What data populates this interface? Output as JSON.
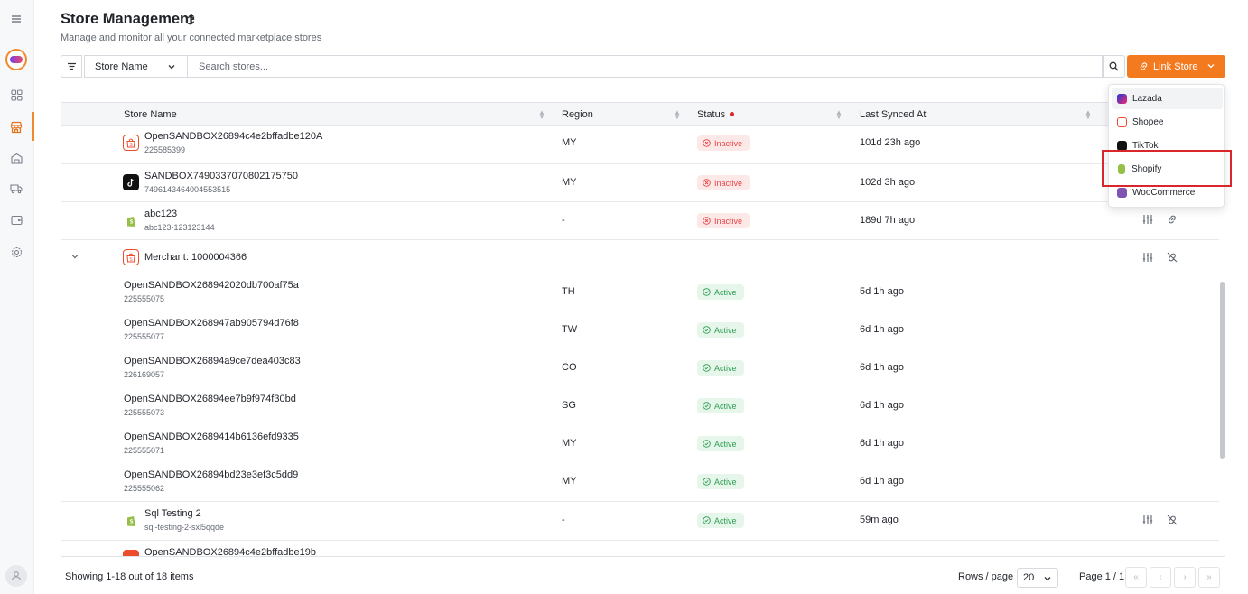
{
  "colors": {
    "accent": "#f47a20",
    "inactive": "#e64545",
    "active": "#2f9e55",
    "highlight": "#d9262c"
  },
  "sidebar": {
    "items": [
      {
        "icon": "menu-icon"
      },
      {
        "icon": "dashboard-icon"
      },
      {
        "icon": "store-icon",
        "active": true
      },
      {
        "icon": "warehouse-icon"
      },
      {
        "icon": "truck-icon"
      },
      {
        "icon": "wallet-icon"
      },
      {
        "icon": "settings-icon"
      }
    ]
  },
  "header": {
    "title": "Store Management",
    "subtitle": "Manage and monitor all your connected marketplace stores"
  },
  "toolbar": {
    "field_select": "Store Name",
    "search_placeholder": "Search stores...",
    "link_store_label": "Link Store"
  },
  "table": {
    "columns": [
      "Store Name",
      "Region",
      "Status",
      "Last Synced At"
    ],
    "rows": [
      {
        "platform": "shopee",
        "name": "OpenSANDBOX26894c4e2bffadbe120A",
        "id": "225585399",
        "region": "MY",
        "status": "Inactive",
        "synced": "101d 23h ago"
      },
      {
        "platform": "tiktok",
        "name": "SANDBOX7490337070802175750",
        "id": "7496143464004553515",
        "region": "MY",
        "status": "Inactive",
        "synced": "102d 3h ago"
      },
      {
        "platform": "shopify",
        "name": "abc123",
        "id": "abc123-123123144",
        "region": "-",
        "status": "Inactive",
        "synced": "189d 7h ago"
      }
    ],
    "merchant": {
      "label": "Merchant: 1000004366",
      "children": [
        {
          "name": "OpenSANDBOX268942020db700af75a",
          "id": "225555075",
          "region": "TH",
          "status": "Active",
          "synced": "5d 1h ago"
        },
        {
          "name": "OpenSANDBOX268947ab905794d76f8",
          "id": "225555077",
          "region": "TW",
          "status": "Active",
          "synced": "6d 1h ago"
        },
        {
          "name": "OpenSANDBOX26894a9ce7dea403c83",
          "id": "226169057",
          "region": "CO",
          "status": "Active",
          "synced": "6d 1h ago"
        },
        {
          "name": "OpenSANDBOX26894ee7b9f974f30bd",
          "id": "225555073",
          "region": "SG",
          "status": "Active",
          "synced": "6d 1h ago"
        },
        {
          "name": "OpenSANDBOX2689414b6136efd9335",
          "id": "225555071",
          "region": "MY",
          "status": "Active",
          "synced": "6d 1h ago"
        },
        {
          "name": "OpenSANDBOX26894bd23e3ef3c5dd9",
          "id": "225555062",
          "region": "MY",
          "status": "Active",
          "synced": "6d 1h ago"
        }
      ]
    },
    "after_rows": [
      {
        "platform": "shopify",
        "name": "Sql Testing 2",
        "id": "sql-testing-2-sxl5qqde",
        "region": "-",
        "status": "Active",
        "synced": "59m ago"
      },
      {
        "platform": "shopee",
        "name": "OpenSANDBOX26894c4e2bffadbe19b"
      }
    ]
  },
  "dropdown": {
    "items": [
      "Lazada",
      "Shopee",
      "TikTok",
      "Shopify",
      "WooCommerce"
    ],
    "highlighted": "Shopify"
  },
  "footer": {
    "showing": "Showing 1-18 out of 18 items",
    "rows_label": "Rows / page",
    "rows_value": "20",
    "page_info": "Page 1 / 1"
  }
}
